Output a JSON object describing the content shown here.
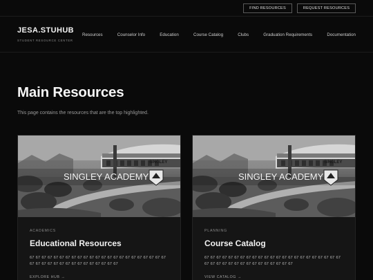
{
  "topbar": {
    "find_label": "FIND RESOURCES",
    "request_label": "REQUEST RESOURCES"
  },
  "brand": {
    "title": "JESA.STUHUB",
    "subtitle": "STUDENT RESOURCE CENTER"
  },
  "nav": {
    "items": [
      {
        "label": "Resources"
      },
      {
        "label": "Counselor Info"
      },
      {
        "label": "Education"
      },
      {
        "label": "Course Catalog"
      },
      {
        "label": "Clubs"
      },
      {
        "label": "Graduation Requirements"
      },
      {
        "label": "Documentation"
      }
    ]
  },
  "hero": {
    "title": "Main Resources",
    "description": "This page contains the resources that are the top highlighted."
  },
  "cards": [
    {
      "image_overlay": "SINGLEY ACADEMY",
      "logo_text": "SINGLEY",
      "category": "ACADEMICS",
      "title": "Educational Resources",
      "text": "67 67 67 67 67 67 67 67 67 67 67 67 67 67 67 67 67 67 67 67 67 67 67 67 67 67 67 67 67 67 67 67 67 67 67 67 67 67",
      "link": "EXPLORE HUB →"
    },
    {
      "image_overlay": "SINGLEY ACADEMY",
      "logo_text": "SINGLEY",
      "category": "PLANNING",
      "title": "Course Catalog",
      "text": "67 67 67 67 67 67 67 67 67 67 67 67 67 67 67 67 67 67 67 67 67 67 67 67 67 67 67 67 67 67 67 67 67 67 67 67 67 67",
      "link": "VIEW CATALOG →"
    }
  ]
}
